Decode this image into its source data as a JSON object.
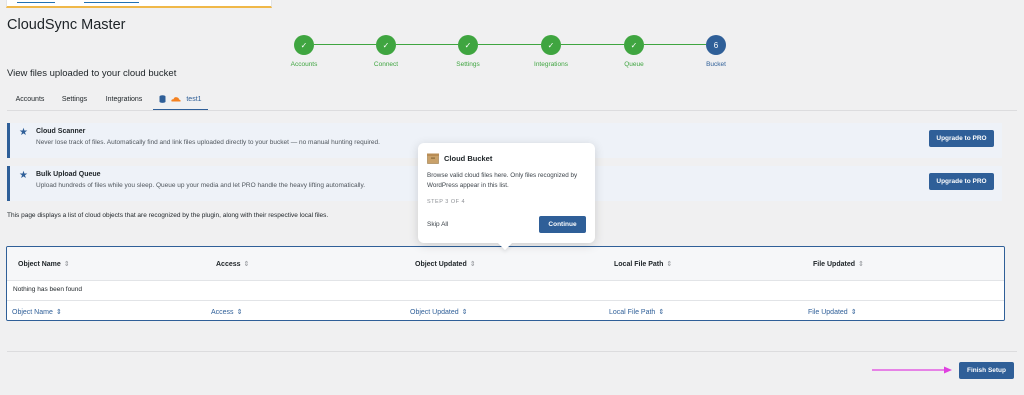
{
  "app": {
    "title": "CloudSync Master"
  },
  "stepper": {
    "steps": [
      {
        "label": "Accounts",
        "state": "done",
        "marker": "✓"
      },
      {
        "label": "Connect",
        "state": "done",
        "marker": "✓"
      },
      {
        "label": "Settings",
        "state": "done",
        "marker": "✓"
      },
      {
        "label": "Integrations",
        "state": "done",
        "marker": "✓"
      },
      {
        "label": "Queue",
        "state": "done",
        "marker": "✓"
      },
      {
        "label": "Bucket",
        "state": "active",
        "marker": "6"
      }
    ]
  },
  "page": {
    "heading": "View files uploaded to your cloud bucket"
  },
  "tabs": [
    {
      "label": "Accounts"
    },
    {
      "label": "Settings"
    },
    {
      "label": "Integrations"
    },
    {
      "label": "test1",
      "active": true,
      "icons": [
        "database-icon",
        "cloud-icon"
      ]
    }
  ],
  "promos": [
    {
      "title": "Cloud Scanner",
      "description": "Never lose track of files. Automatically find and link files uploaded directly to your bucket — no manual hunting required.",
      "button": "Upgrade to PRO"
    },
    {
      "title": "Bulk Upload Queue",
      "description": "Upload hundreds of files while you sleep. Queue up your media and let PRO handle the heavy lifting automatically.",
      "button": "Upgrade to PRO"
    }
  ],
  "info_text": "This page displays a list of cloud objects that are recognized by the plugin, along with their respective local files.",
  "table": {
    "columns": [
      "Object Name",
      "Access",
      "Object Updated",
      "Local File Path",
      "File Updated"
    ],
    "empty_message": "Nothing has been found",
    "sort_glyph": "⇕"
  },
  "tooltip": {
    "title": "Cloud Bucket",
    "body": "Browse valid cloud files here. Only files recognized by WordPress appear in this list.",
    "step_indicator": "STEP 3 OF 4",
    "skip_label": "Skip All",
    "continue_label": "Continue"
  },
  "footer": {
    "finish_label": "Finish Setup"
  },
  "colors": {
    "accent": "#2f5f98",
    "success": "#3fa540",
    "annotation_arrow": "#e040e0",
    "notice_border": "#f0b849"
  }
}
